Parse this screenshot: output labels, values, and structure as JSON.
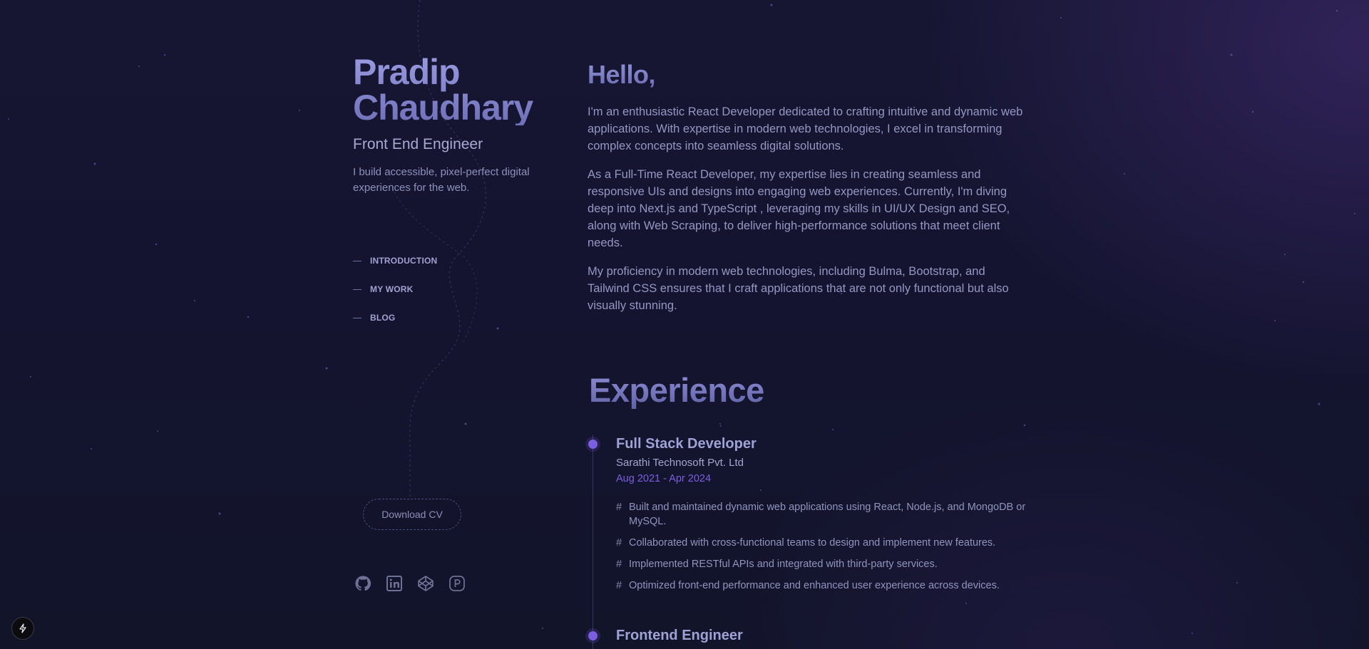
{
  "profile": {
    "name_line1": "Pradip",
    "name_line2": "Chaudhary",
    "role": "Front End Engineer",
    "tagline": "I build accessible, pixel-perfect digital experiences for the web."
  },
  "nav": {
    "items": [
      {
        "label": "INTRODUCTION"
      },
      {
        "label": "MY WORK"
      },
      {
        "label": "BLOG"
      }
    ]
  },
  "cv": {
    "label": "Download CV"
  },
  "socials": [
    {
      "icon": "github-icon"
    },
    {
      "icon": "linkedin-icon"
    },
    {
      "icon": "codepen-icon"
    },
    {
      "icon": "product-hunt-icon"
    }
  ],
  "intro": {
    "heading": "Hello,",
    "paragraphs": [
      "I'm an enthusiastic React Developer dedicated to crafting intuitive and dynamic web applications. With expertise in modern web technologies, I excel in transforming complex concepts into seamless digital solutions.",
      "As a Full-Time React Developer, my expertise lies in creating seamless and responsive UIs and designs into engaging web experiences. Currently, I'm diving deep into Next.js and TypeScript , leveraging my skills in UI/UX Design and SEO, along with Web Scraping, to deliver high-performance solutions that meet client needs.",
      "My proficiency in modern web technologies, including Bulma, Bootstrap, and Tailwind CSS ensures that I craft applications that are not only functional but also visually stunning."
    ]
  },
  "experience": {
    "heading": "Experience",
    "jobs": [
      {
        "title": "Full Stack Developer",
        "company": "Sarathi Technosoft Pvt. Ltd",
        "dates": "Aug 2021 - Apr 2024",
        "bullet_symbol": "#",
        "points": [
          "Built and maintained dynamic web applications using React, Node.js, and MongoDB or MySQL.",
          "Collaborated with cross-functional teams to design and implement new features.",
          "Implemented RESTful APIs and integrated with third-party services.",
          "Optimized front-end performance and enhanced user experience across devices."
        ]
      },
      {
        "title": "Frontend Engineer"
      }
    ]
  },
  "colors": {
    "accent": "#7b5fe0",
    "background": "#141430",
    "text": "#9597c2"
  }
}
